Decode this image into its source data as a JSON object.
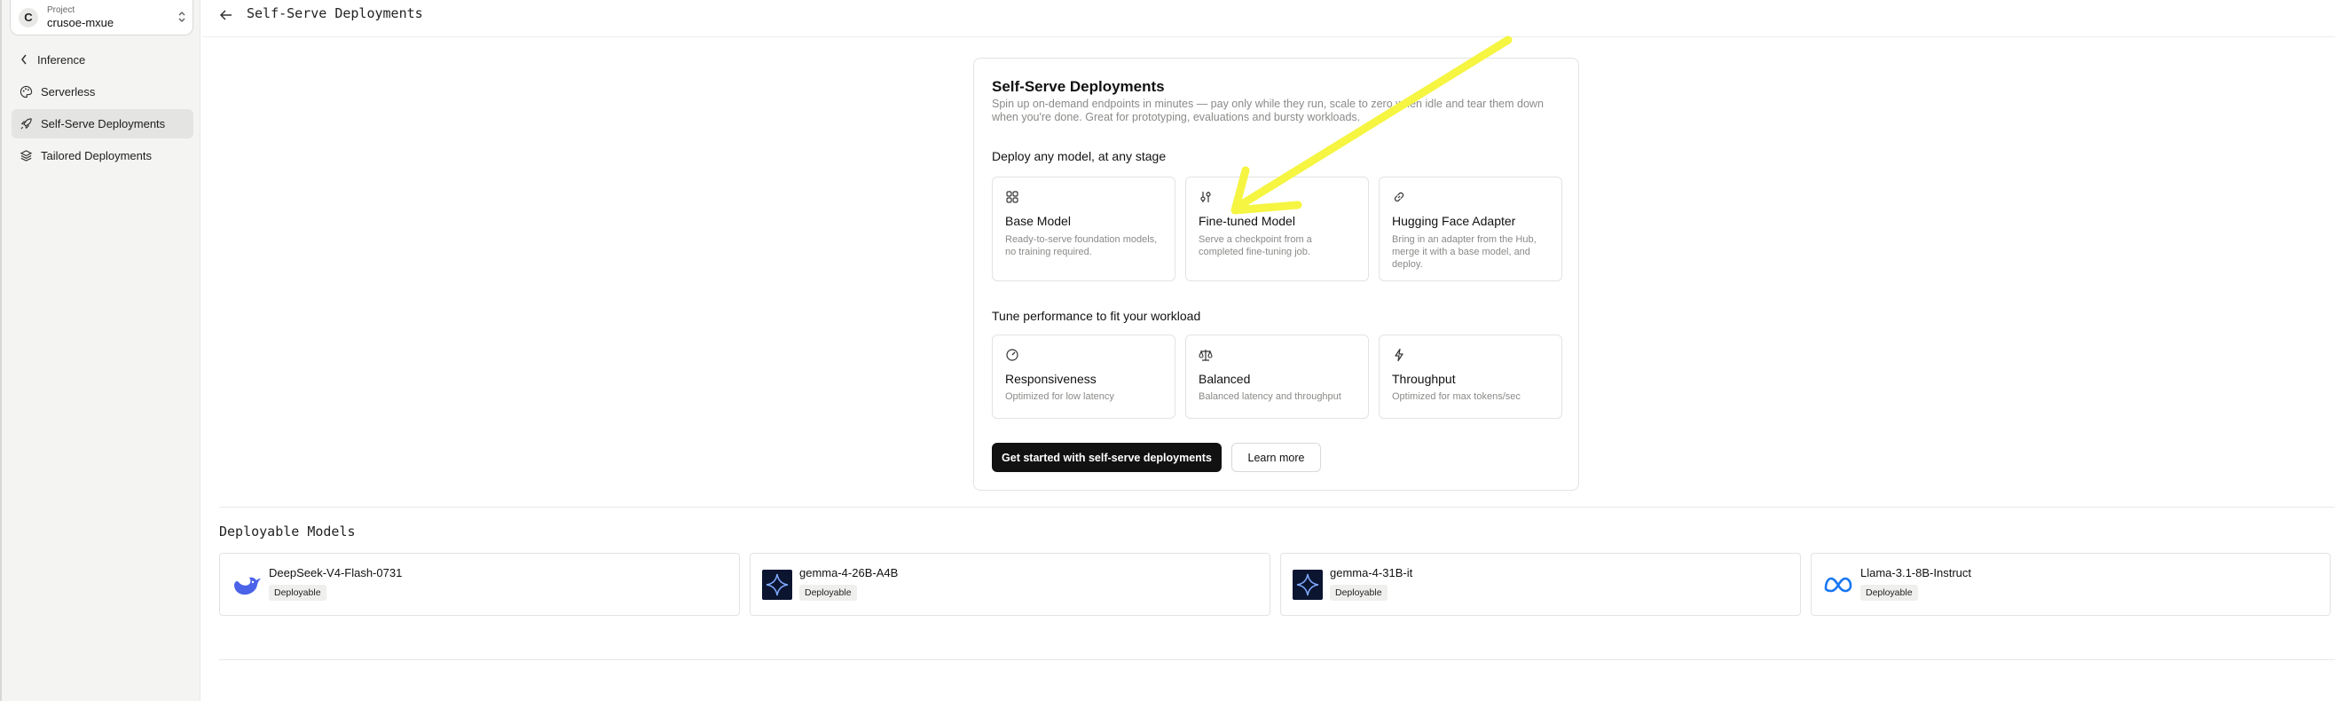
{
  "sidebar": {
    "project": {
      "avatar": "C",
      "label": "Project",
      "name": "crusoe-mxue"
    },
    "back_label": "Inference",
    "items": [
      {
        "label": "Serverless",
        "icon": "palette-icon"
      },
      {
        "label": "Self-Serve Deployments",
        "icon": "rocket-icon",
        "active": true
      },
      {
        "label": "Tailored Deployments",
        "icon": "layers-icon"
      }
    ]
  },
  "topbar": {
    "title": "Self-Serve Deployments"
  },
  "card": {
    "title": "Self-Serve Deployments",
    "description": "Spin up on-demand endpoints in minutes — pay only while they run, scale to zero when idle and tear them down when you're done. Great for prototyping, evaluations and bursty workloads.",
    "section1_title": "Deploy any model, at any stage",
    "models": [
      {
        "name": "Base Model",
        "desc": "Ready-to-serve foundation models, no training required.",
        "icon": "grid-icon"
      },
      {
        "name": "Fine-tuned Model",
        "desc": "Serve a checkpoint from a completed fine-tuning job.",
        "icon": "sliders-icon"
      },
      {
        "name": "Hugging Face Adapter",
        "desc": "Bring in an adapter from the Hub, merge it with a base model, and deploy.",
        "icon": "link-icon"
      }
    ],
    "section2_title": "Tune performance to fit your workload",
    "perf": [
      {
        "name": "Responsiveness",
        "desc": "Optimized for low latency",
        "icon": "gauge-icon"
      },
      {
        "name": "Balanced",
        "desc": "Balanced latency and throughput",
        "icon": "scale-icon"
      },
      {
        "name": "Throughput",
        "desc": "Optimized for max tokens/sec",
        "icon": "bolt-icon"
      }
    ],
    "primary_button": "Get started with self-serve deployments",
    "secondary_button": "Learn more"
  },
  "deployable": {
    "title": "Deployable Models",
    "models": [
      {
        "name": "DeepSeek-V4-Flash-0731",
        "badge": "Deployable",
        "logo": "deepseek-logo"
      },
      {
        "name": "gemma-4-26B-A4B",
        "badge": "Deployable",
        "logo": "gemma-logo"
      },
      {
        "name": "gemma-4-31B-it",
        "badge": "Deployable",
        "logo": "gemma-logo"
      },
      {
        "name": "Llama-3.1-8B-Instruct",
        "badge": "Deployable",
        "logo": "meta-logo"
      }
    ]
  },
  "colors": {
    "annotation_arrow": "#f5f542",
    "primary_button": "#111111",
    "sidebar_bg": "#f4f4f3"
  }
}
